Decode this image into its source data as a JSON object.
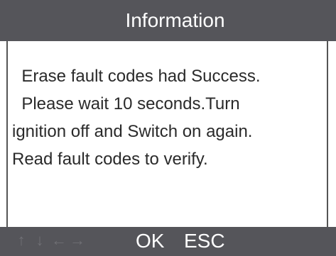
{
  "header": {
    "title": "Information"
  },
  "message": {
    "lines": [
      "  Erase fault codes had Success.",
      "  Please wait 10 seconds.Turn",
      "ignition off and Switch on again.",
      "Read fault codes to verify."
    ]
  },
  "footer": {
    "arrows": {
      "up": "↑",
      "down": "↓",
      "left": "←",
      "right": "→"
    },
    "ok_label": "OK",
    "esc_label": "ESC"
  },
  "colors": {
    "bar_background": "#55555a",
    "text": "#2a2a2a",
    "inactive_arrows": "#6f6f74"
  }
}
